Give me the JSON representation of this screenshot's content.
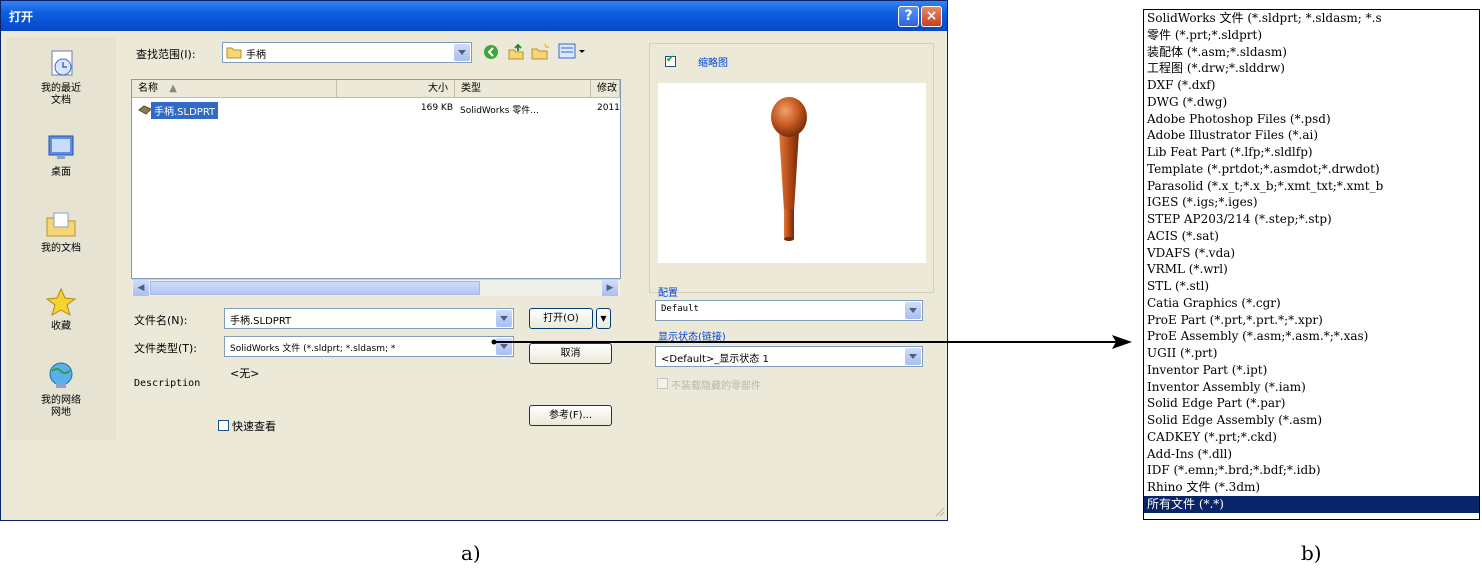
{
  "window": {
    "title": "打开",
    "help_symbol": "?",
    "close_symbol": "×"
  },
  "places": [
    {
      "label": "我的最近\n文档",
      "icon": "recent-documents-icon"
    },
    {
      "label": "桌面",
      "icon": "desktop-icon"
    },
    {
      "label": "我的文档",
      "icon": "my-documents-icon"
    },
    {
      "label": "收藏",
      "icon": "favorites-star-icon"
    },
    {
      "label": "我的网络\n网地",
      "icon": "network-places-icon"
    }
  ],
  "toolbar": {
    "look_in_label": "查找范围(I):",
    "look_in_value": "手柄"
  },
  "file_list": {
    "headers": [
      "名称",
      "大小",
      "类型",
      "修改"
    ],
    "rows": [
      {
        "name": "手柄.SLDPRT",
        "size": "169 KB",
        "type": "SolidWorks 零件...",
        "modified": "2011"
      }
    ]
  },
  "form": {
    "file_name_label": "文件名(N):",
    "file_name_value": "手柄.SLDPRT",
    "file_type_label": "文件类型(T):",
    "file_type_value": "SolidWorks 文件 (*.sldprt; *.sldasm; *",
    "description_label": "Description",
    "description_value": "<无>",
    "quick_view_label": "快速查看",
    "open_label": "打开(O)",
    "cancel_label": "取消",
    "reference_label": "参考(F)..."
  },
  "preview": {
    "thumbnail_label": "缩略图",
    "thumbnail_checked": true,
    "config_label": "配置",
    "config_value": "Default",
    "display_state_label": "显示状态(链接)",
    "display_state_value": "<Default>_显示状态 1",
    "hidden_parts_label": "不装载隐藏的零部件"
  },
  "file_types": [
    "SolidWorks 文件 (*.sldprt; *.sldasm; *.s",
    "零件 (*.prt;*.sldprt)",
    "装配体 (*.asm;*.sldasm)",
    "工程图 (*.drw;*.slddrw)",
    "DXF (*.dxf)",
    "DWG (*.dwg)",
    "Adobe Photoshop Files (*.psd)",
    "Adobe Illustrator Files (*.ai)",
    "Lib Feat Part (*.lfp;*.sldlfp)",
    "Template (*.prtdot;*.asmdot;*.drwdot)",
    "Parasolid (*.x_t;*.x_b;*.xmt_txt;*.xmt_b",
    "IGES (*.igs;*.iges)",
    "STEP AP203/214 (*.step;*.stp)",
    "ACIS (*.sat)",
    "VDAFS (*.vda)",
    "VRML (*.wrl)",
    "STL (*.stl)",
    "Catia Graphics (*.cgr)",
    "ProE Part (*.prt,*.prt.*;*.xpr)",
    "ProE Assembly (*.asm;*.asm.*;*.xas)",
    "UGII (*.prt)",
    "Inventor Part (*.ipt)",
    "Inventor Assembly (*.iam)",
    "Solid Edge Part (*.par)",
    "Solid Edge Assembly (*.asm)",
    "CADKEY (*.prt;*.ckd)",
    "Add-Ins (*.dll)",
    "IDF (*.emn;*.brd;*.bdf;*.idb)",
    "Rhino 文件 (*.3dm)",
    "所有文件 (*.*)"
  ],
  "selected_file_type_index": 29,
  "captions": {
    "a": "a)",
    "b": "b)"
  },
  "colors": {
    "title_blue": "#0a5fe0",
    "selection": "#0a246a",
    "dialog_bg": "#ece9d8"
  }
}
